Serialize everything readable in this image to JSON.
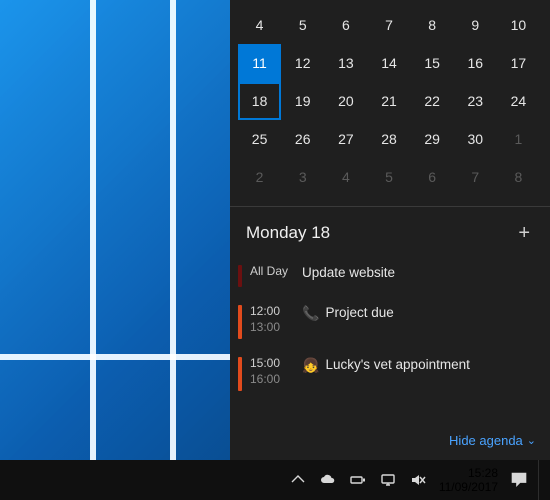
{
  "calendar": {
    "rows": [
      {
        "cells": [
          {
            "n": "4"
          },
          {
            "n": "5"
          },
          {
            "n": "6"
          },
          {
            "n": "7"
          },
          {
            "n": "8"
          },
          {
            "n": "9"
          },
          {
            "n": "10"
          }
        ]
      },
      {
        "cells": [
          {
            "n": "11",
            "selected": true
          },
          {
            "n": "12"
          },
          {
            "n": "13"
          },
          {
            "n": "14"
          },
          {
            "n": "15"
          },
          {
            "n": "16"
          },
          {
            "n": "17"
          }
        ]
      },
      {
        "cells": [
          {
            "n": "18",
            "todayBorder": true
          },
          {
            "n": "19"
          },
          {
            "n": "20"
          },
          {
            "n": "21"
          },
          {
            "n": "22"
          },
          {
            "n": "23"
          },
          {
            "n": "24"
          }
        ]
      },
      {
        "cells": [
          {
            "n": "25"
          },
          {
            "n": "26"
          },
          {
            "n": "27"
          },
          {
            "n": "28"
          },
          {
            "n": "29"
          },
          {
            "n": "30"
          },
          {
            "n": "1",
            "dim": true
          }
        ]
      },
      {
        "cells": [
          {
            "n": "2",
            "dim": true
          },
          {
            "n": "3",
            "dim": true
          },
          {
            "n": "4",
            "dim": true
          },
          {
            "n": "5",
            "dim": true
          },
          {
            "n": "6",
            "dim": true
          },
          {
            "n": "7",
            "dim": true
          },
          {
            "n": "8",
            "dim": true
          }
        ]
      }
    ]
  },
  "agenda": {
    "title": "Monday 18",
    "add_label": "+",
    "hide_label": "Hide agenda",
    "events": [
      {
        "all_day": true,
        "when_label": "All Day",
        "title": "Update website"
      },
      {
        "all_day": false,
        "start": "12:00",
        "end": "13:00",
        "icon": "phone",
        "title": "Project due"
      },
      {
        "all_day": false,
        "start": "15:00",
        "end": "16:00",
        "icon": "girl",
        "title": "Lucky's vet appointment"
      }
    ]
  },
  "taskbar": {
    "time": "15:28",
    "date": "11/09/2017"
  }
}
